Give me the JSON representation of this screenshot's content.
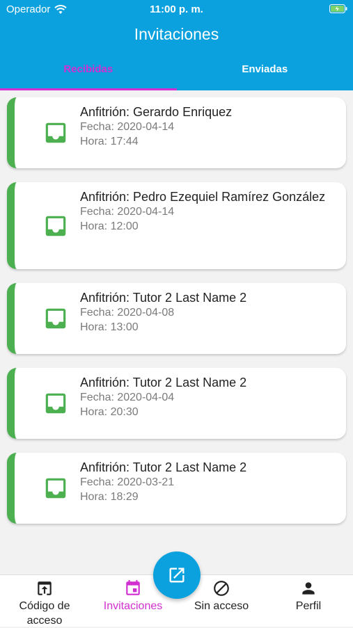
{
  "status": {
    "carrier": "Operador",
    "time": "11:00 p. m."
  },
  "header": {
    "title": "Invitaciones"
  },
  "tabs": [
    {
      "label": "Recibidas",
      "active": true
    },
    {
      "label": "Enviadas",
      "active": false
    }
  ],
  "invitations": [
    {
      "host": "Anfitrión: Gerardo Enriquez",
      "date": "Fecha: 2020-04-14",
      "time": "Hora: 17:44"
    },
    {
      "host": "Anfitrión: Pedro Ezequiel Ramírez González",
      "date": "Fecha: 2020-04-14",
      "time": "Hora: 12:00"
    },
    {
      "host": "Anfitrión: Tutor 2 Last Name 2",
      "date": "Fecha: 2020-04-08",
      "time": "Hora: 13:00"
    },
    {
      "host": "Anfitrión: Tutor 2 Last Name 2",
      "date": "Fecha: 2020-04-04",
      "time": "Hora: 20:30"
    },
    {
      "host": "Anfitrión: Tutor 2 Last Name 2",
      "date": "Fecha: 2020-03-21",
      "time": "Hora: 18:29"
    }
  ],
  "bottom_nav": [
    {
      "label": "Código de acceso",
      "icon": "upload-box-icon"
    },
    {
      "label": "Invitaciones",
      "icon": "calendar-icon",
      "active": true
    },
    {
      "label": "Sin acceso",
      "icon": "block-icon"
    },
    {
      "label": "Perfil",
      "icon": "person-icon"
    }
  ],
  "fab": {
    "icon": "open-in-new-icon"
  },
  "colors": {
    "primary": "#0aa1de",
    "accent": "#d12fd1",
    "card_stripe": "#4caf50"
  }
}
